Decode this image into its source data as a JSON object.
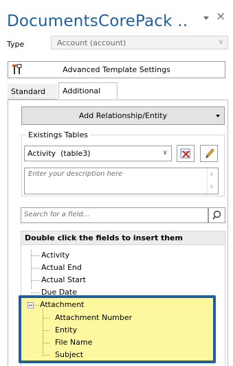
{
  "header": {
    "title": "DocumentsCorePack ..",
    "menu_icon": "dropdown-triangle-icon",
    "close_label": "×"
  },
  "type_row": {
    "label": "Type",
    "value": "Account (account)"
  },
  "advanced_button": {
    "label": "Advanced Template Settings",
    "icon": "tools-icon"
  },
  "tabs": [
    {
      "label": "Standard"
    },
    {
      "label": "Additional",
      "active": true
    }
  ],
  "add_relationship": {
    "label": "Add Relationship/Entity"
  },
  "existing_tables": {
    "legend": "Existings Tables",
    "selected": "Activity  (table3)",
    "description_placeholder": "Enter your description here"
  },
  "search": {
    "placeholder": "Search for a field..."
  },
  "fields": {
    "header": "Double click the fields to insert them",
    "items": [
      {
        "label": "Activity"
      },
      {
        "label": "Actual End"
      },
      {
        "label": "Actual Start"
      },
      {
        "label": "Due Date"
      },
      {
        "label": "Attachment",
        "expanded": true,
        "children": [
          {
            "label": "Attachment Number"
          },
          {
            "label": "Entity"
          },
          {
            "label": "File Name"
          },
          {
            "label": "Subject"
          }
        ]
      }
    ]
  },
  "colors": {
    "title": "#1f5f9c",
    "highlight": "#fdf8a0",
    "highlight_border": "#1f5f9c"
  }
}
